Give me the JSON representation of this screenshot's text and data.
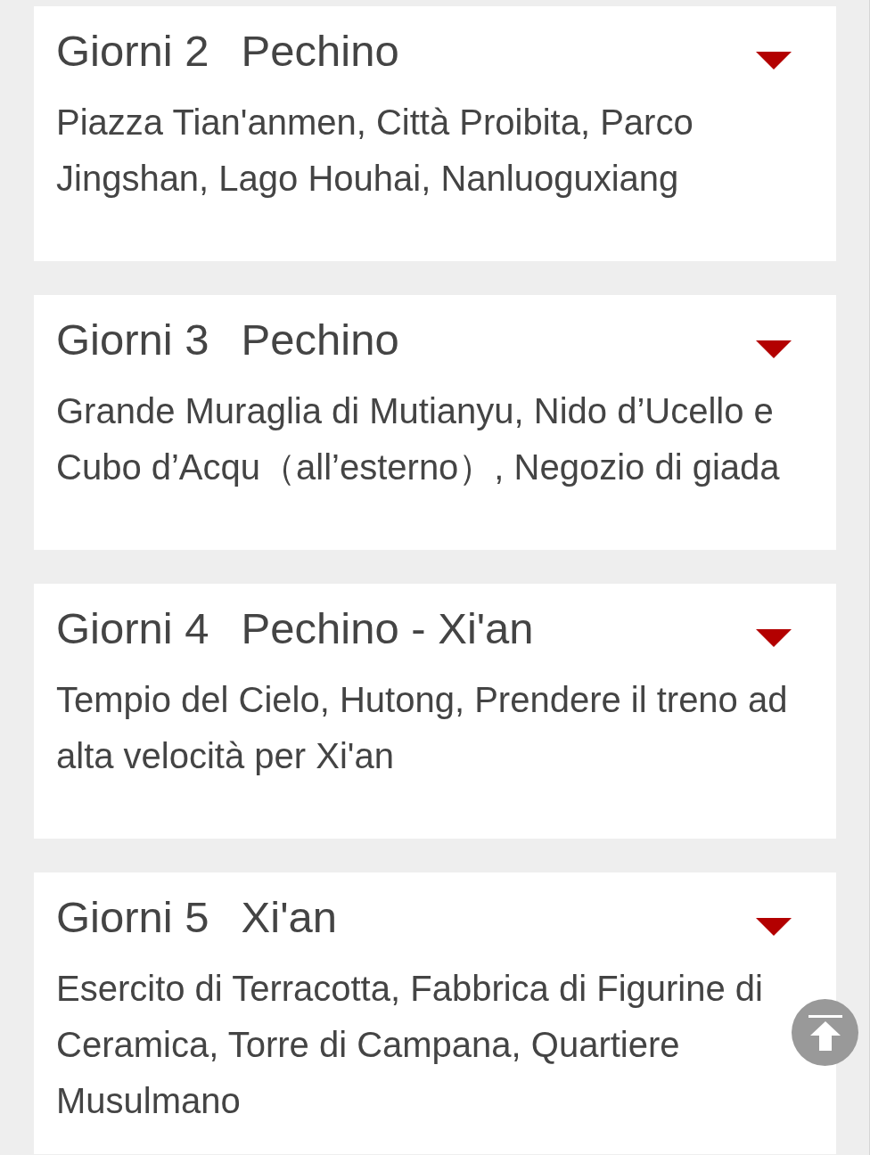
{
  "itinerary": [
    {
      "day": "Giorni 2",
      "place": "Pechino",
      "description": "Piazza Tian'anmen, Città Proibita, Parco Jingshan, Lago Houhai, Nanluoguxiang"
    },
    {
      "day": "Giorni 3",
      "place": "Pechino",
      "description": "Grande Muraglia di Mutianyu, Nido d’Ucello e Cubo d’Acqu（all’esterno）, Negozio di giada"
    },
    {
      "day": "Giorni 4",
      "place": "Pechino - Xi'an",
      "description": "Tempio del Cielo, Hutong, Prendere il treno ad alta velocità per Xi'an"
    },
    {
      "day": "Giorni 5",
      "place": "Xi'an",
      "description": "Esercito di Terracotta, Fabbrica di Figurine di Ceramica, Torre di Campana, Quartiere Musulmano"
    }
  ]
}
